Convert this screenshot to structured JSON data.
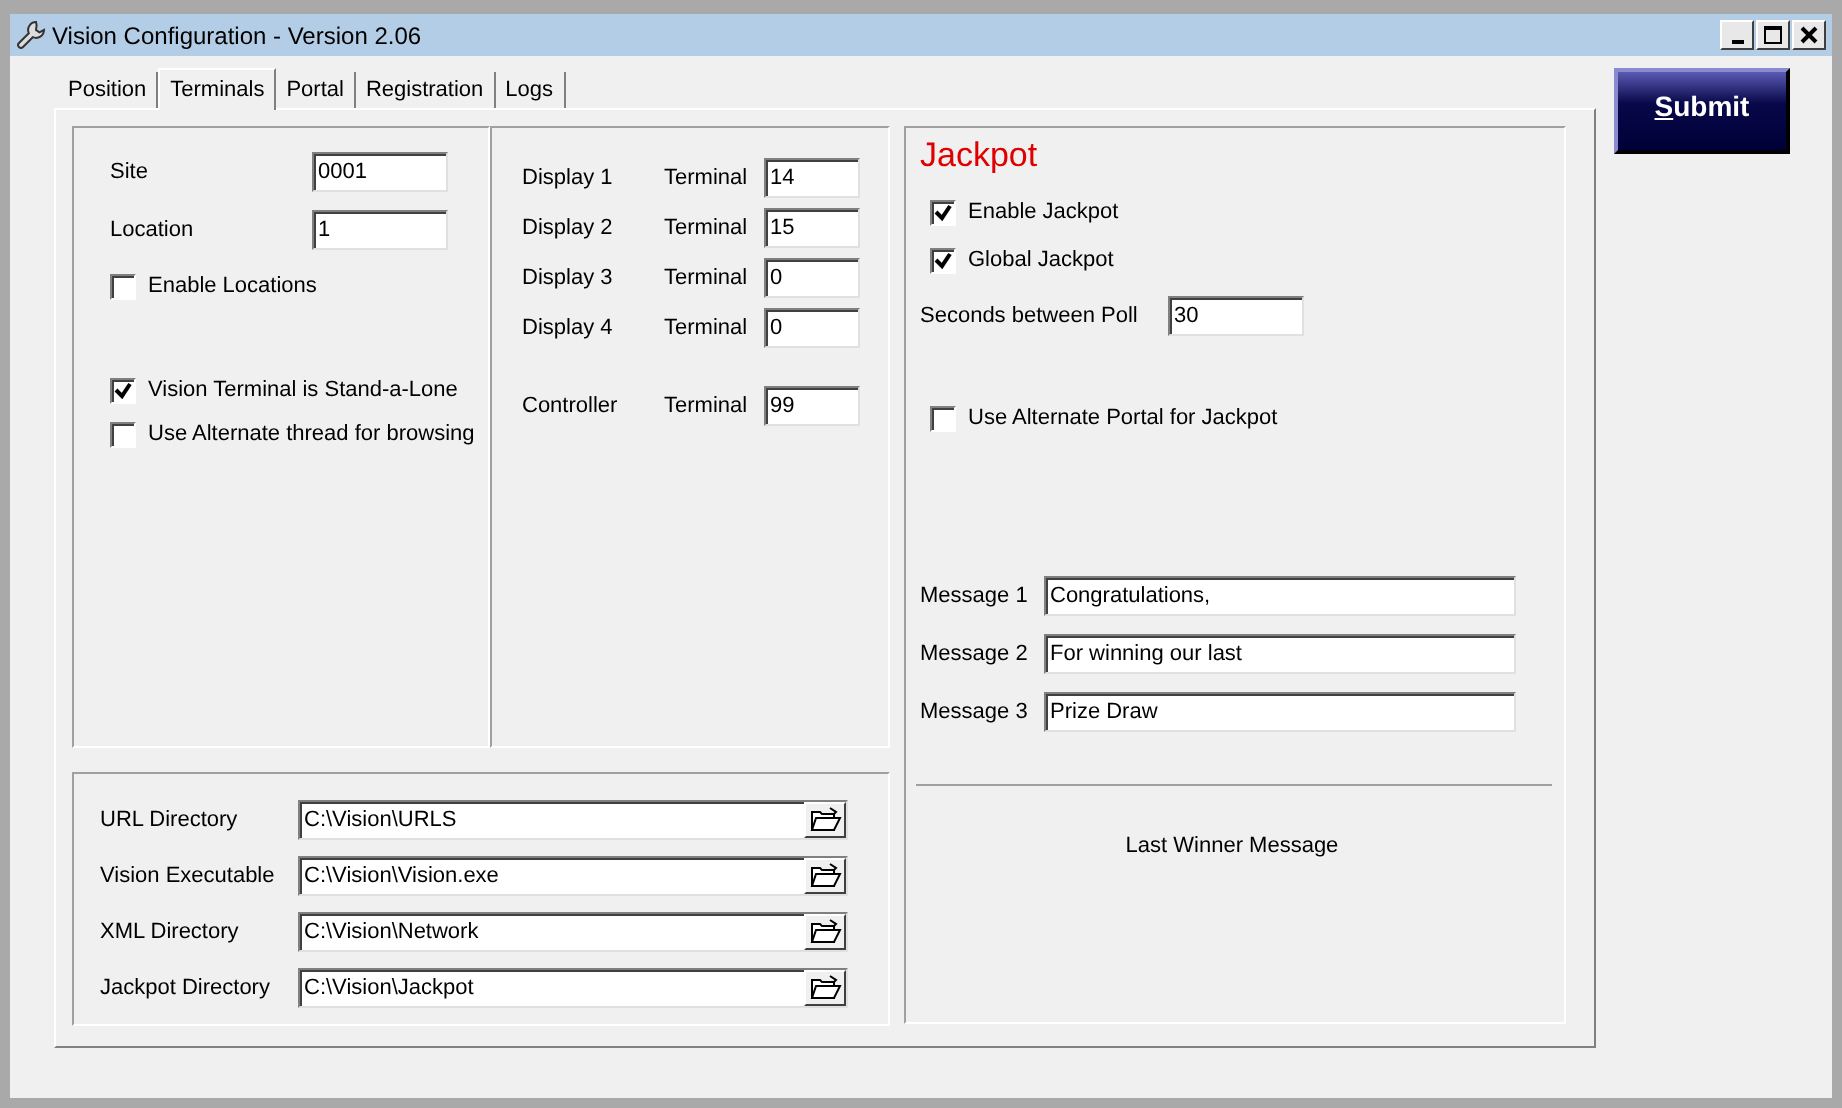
{
  "window": {
    "title": "Vision Configuration - Version 2.06"
  },
  "tabs": [
    {
      "label": "Position",
      "selected": false
    },
    {
      "label": "Terminals",
      "selected": true
    },
    {
      "label": "Portal",
      "selected": false
    },
    {
      "label": "Registration",
      "selected": false
    },
    {
      "label": "Logs",
      "selected": false
    }
  ],
  "site_panel": {
    "fields": [
      {
        "label": "Site",
        "value": "0001"
      },
      {
        "label": "Location",
        "value": "1"
      }
    ],
    "enable_locations": {
      "label": "Enable Locations",
      "checked": false
    },
    "options": [
      {
        "label": "Vision Terminal is Stand-a-Lone",
        "checked": true
      },
      {
        "label": "Use Alternate thread for browsing",
        "checked": false
      }
    ]
  },
  "display_panel": {
    "displays": [
      {
        "label": "Display 1",
        "terminal_label": "Terminal",
        "value": "14"
      },
      {
        "label": "Display 2",
        "terminal_label": "Terminal",
        "value": "15"
      },
      {
        "label": "Display 3",
        "terminal_label": "Terminal",
        "value": "0"
      },
      {
        "label": "Display 4",
        "terminal_label": "Terminal",
        "value": "0"
      }
    ],
    "controller": {
      "label": "Controller",
      "terminal_label": "Terminal",
      "value": "99"
    }
  },
  "directories": [
    {
      "label": "URL Directory",
      "value": "C:\\Vision\\URLS"
    },
    {
      "label": "Vision Executable",
      "value": "C:\\Vision\\Vision.exe"
    },
    {
      "label": "XML Directory",
      "value": "C:\\Vision\\Network"
    },
    {
      "label": "Jackpot Directory",
      "value": "C:\\Vision\\Jackpot"
    }
  ],
  "jackpot": {
    "title": "Jackpot",
    "checkboxes": [
      {
        "label": "Enable Jackpot",
        "checked": true
      },
      {
        "label": "Global Jackpot",
        "checked": true
      }
    ],
    "poll": {
      "label": "Seconds between Poll",
      "value": "30"
    },
    "alternate_portal": {
      "label": "Use Alternate Portal for Jackpot",
      "checked": false
    },
    "messages": [
      {
        "label": "Message 1",
        "value": "Congratulations,"
      },
      {
        "label": "Message 2",
        "value": "For winning our last"
      },
      {
        "label": "Message 3",
        "value": "Prize Draw"
      }
    ],
    "last_winner_label": "Last Winner Message"
  },
  "submit": {
    "mnemonic": "S",
    "rest": "ubmit"
  }
}
